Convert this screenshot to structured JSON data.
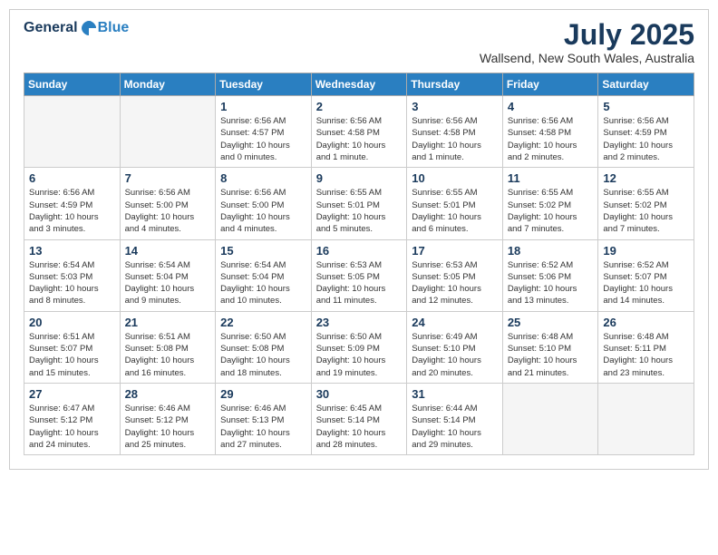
{
  "logo": {
    "general": "General",
    "blue": "Blue"
  },
  "title": "July 2025",
  "location": "Wallsend, New South Wales, Australia",
  "days_of_week": [
    "Sunday",
    "Monday",
    "Tuesday",
    "Wednesday",
    "Thursday",
    "Friday",
    "Saturday"
  ],
  "weeks": [
    [
      {
        "day": "",
        "info": ""
      },
      {
        "day": "",
        "info": ""
      },
      {
        "day": "1",
        "info": "Sunrise: 6:56 AM\nSunset: 4:57 PM\nDaylight: 10 hours\nand 0 minutes."
      },
      {
        "day": "2",
        "info": "Sunrise: 6:56 AM\nSunset: 4:58 PM\nDaylight: 10 hours\nand 1 minute."
      },
      {
        "day": "3",
        "info": "Sunrise: 6:56 AM\nSunset: 4:58 PM\nDaylight: 10 hours\nand 1 minute."
      },
      {
        "day": "4",
        "info": "Sunrise: 6:56 AM\nSunset: 4:58 PM\nDaylight: 10 hours\nand 2 minutes."
      },
      {
        "day": "5",
        "info": "Sunrise: 6:56 AM\nSunset: 4:59 PM\nDaylight: 10 hours\nand 2 minutes."
      }
    ],
    [
      {
        "day": "6",
        "info": "Sunrise: 6:56 AM\nSunset: 4:59 PM\nDaylight: 10 hours\nand 3 minutes."
      },
      {
        "day": "7",
        "info": "Sunrise: 6:56 AM\nSunset: 5:00 PM\nDaylight: 10 hours\nand 4 minutes."
      },
      {
        "day": "8",
        "info": "Sunrise: 6:56 AM\nSunset: 5:00 PM\nDaylight: 10 hours\nand 4 minutes."
      },
      {
        "day": "9",
        "info": "Sunrise: 6:55 AM\nSunset: 5:01 PM\nDaylight: 10 hours\nand 5 minutes."
      },
      {
        "day": "10",
        "info": "Sunrise: 6:55 AM\nSunset: 5:01 PM\nDaylight: 10 hours\nand 6 minutes."
      },
      {
        "day": "11",
        "info": "Sunrise: 6:55 AM\nSunset: 5:02 PM\nDaylight: 10 hours\nand 7 minutes."
      },
      {
        "day": "12",
        "info": "Sunrise: 6:55 AM\nSunset: 5:02 PM\nDaylight: 10 hours\nand 7 minutes."
      }
    ],
    [
      {
        "day": "13",
        "info": "Sunrise: 6:54 AM\nSunset: 5:03 PM\nDaylight: 10 hours\nand 8 minutes."
      },
      {
        "day": "14",
        "info": "Sunrise: 6:54 AM\nSunset: 5:04 PM\nDaylight: 10 hours\nand 9 minutes."
      },
      {
        "day": "15",
        "info": "Sunrise: 6:54 AM\nSunset: 5:04 PM\nDaylight: 10 hours\nand 10 minutes."
      },
      {
        "day": "16",
        "info": "Sunrise: 6:53 AM\nSunset: 5:05 PM\nDaylight: 10 hours\nand 11 minutes."
      },
      {
        "day": "17",
        "info": "Sunrise: 6:53 AM\nSunset: 5:05 PM\nDaylight: 10 hours\nand 12 minutes."
      },
      {
        "day": "18",
        "info": "Sunrise: 6:52 AM\nSunset: 5:06 PM\nDaylight: 10 hours\nand 13 minutes."
      },
      {
        "day": "19",
        "info": "Sunrise: 6:52 AM\nSunset: 5:07 PM\nDaylight: 10 hours\nand 14 minutes."
      }
    ],
    [
      {
        "day": "20",
        "info": "Sunrise: 6:51 AM\nSunset: 5:07 PM\nDaylight: 10 hours\nand 15 minutes."
      },
      {
        "day": "21",
        "info": "Sunrise: 6:51 AM\nSunset: 5:08 PM\nDaylight: 10 hours\nand 16 minutes."
      },
      {
        "day": "22",
        "info": "Sunrise: 6:50 AM\nSunset: 5:08 PM\nDaylight: 10 hours\nand 18 minutes."
      },
      {
        "day": "23",
        "info": "Sunrise: 6:50 AM\nSunset: 5:09 PM\nDaylight: 10 hours\nand 19 minutes."
      },
      {
        "day": "24",
        "info": "Sunrise: 6:49 AM\nSunset: 5:10 PM\nDaylight: 10 hours\nand 20 minutes."
      },
      {
        "day": "25",
        "info": "Sunrise: 6:48 AM\nSunset: 5:10 PM\nDaylight: 10 hours\nand 21 minutes."
      },
      {
        "day": "26",
        "info": "Sunrise: 6:48 AM\nSunset: 5:11 PM\nDaylight: 10 hours\nand 23 minutes."
      }
    ],
    [
      {
        "day": "27",
        "info": "Sunrise: 6:47 AM\nSunset: 5:12 PM\nDaylight: 10 hours\nand 24 minutes."
      },
      {
        "day": "28",
        "info": "Sunrise: 6:46 AM\nSunset: 5:12 PM\nDaylight: 10 hours\nand 25 minutes."
      },
      {
        "day": "29",
        "info": "Sunrise: 6:46 AM\nSunset: 5:13 PM\nDaylight: 10 hours\nand 27 minutes."
      },
      {
        "day": "30",
        "info": "Sunrise: 6:45 AM\nSunset: 5:14 PM\nDaylight: 10 hours\nand 28 minutes."
      },
      {
        "day": "31",
        "info": "Sunrise: 6:44 AM\nSunset: 5:14 PM\nDaylight: 10 hours\nand 29 minutes."
      },
      {
        "day": "",
        "info": ""
      },
      {
        "day": "",
        "info": ""
      }
    ]
  ]
}
